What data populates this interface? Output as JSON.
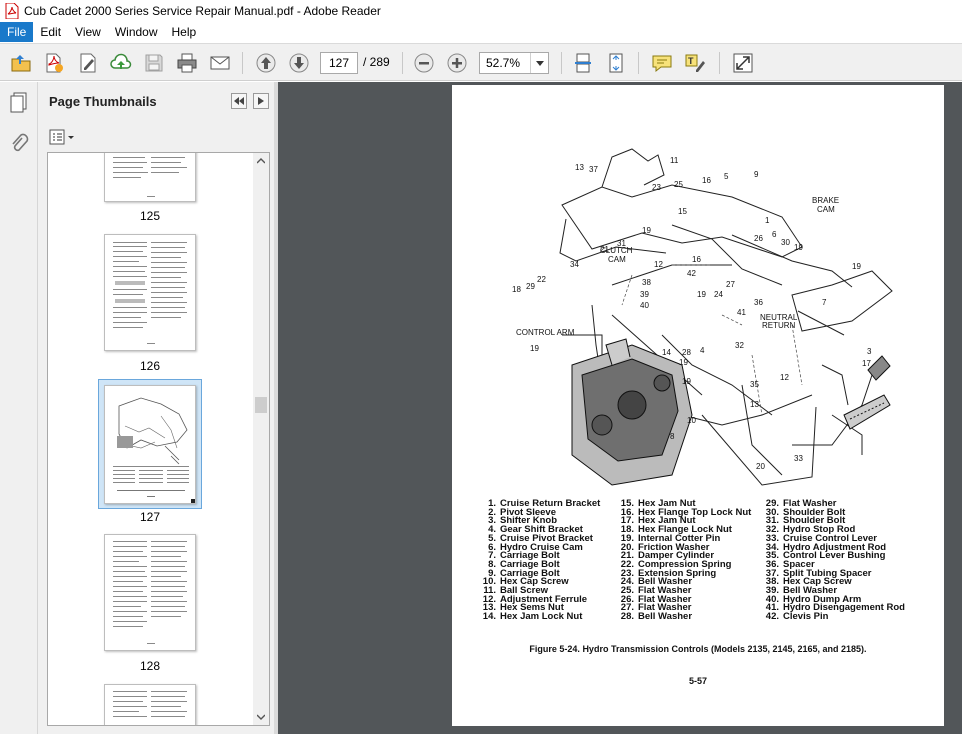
{
  "window": {
    "title": "Cub Cadet 2000 Series Service Repair Manual.pdf - Adobe Reader"
  },
  "menu": {
    "items": [
      "File",
      "Edit",
      "View",
      "Window",
      "Help"
    ]
  },
  "toolbar": {
    "current_page": "127",
    "total_pages": "/ 289",
    "zoom": "52.7%"
  },
  "panel": {
    "title": "Page Thumbnails",
    "thumbnails": [
      {
        "label": "125"
      },
      {
        "label": "126"
      },
      {
        "label": "127"
      },
      {
        "label": "128"
      }
    ]
  },
  "document": {
    "figure": {
      "callouts": [
        "13",
        "37",
        "11",
        "16",
        "5",
        "9",
        "23",
        "25",
        "19",
        "15",
        "1",
        "6",
        "21",
        "31",
        "16",
        "26",
        "30",
        "19",
        "12",
        "42",
        "19",
        "24",
        "27",
        "36",
        "34",
        "38",
        "39",
        "40",
        "22",
        "29",
        "18",
        "41",
        "19",
        "14",
        "28",
        "4",
        "32",
        "12",
        "3",
        "17",
        "35",
        "10",
        "13",
        "8",
        "20",
        "33",
        "7"
      ],
      "labels": {
        "brake_cam": [
          "BRAKE",
          "CAM"
        ],
        "clutch_cam": [
          "CLUTCH",
          "CAM"
        ],
        "neutral_return": [
          "NEUTRAL",
          "RETURN"
        ],
        "control_arm": "CONTROL ARM"
      }
    },
    "legend_col1": [
      {
        "n": "1.",
        "t": "Cruise Return Bracket"
      },
      {
        "n": "2.",
        "t": "Pivot Sleeve"
      },
      {
        "n": "3.",
        "t": "Shifter Knob"
      },
      {
        "n": "4.",
        "t": "Gear Shift Bracket"
      },
      {
        "n": "5.",
        "t": "Cruise Pivot Bracket"
      },
      {
        "n": "6.",
        "t": "Hydro Cruise Cam"
      },
      {
        "n": "7.",
        "t": "Carriage Bolt"
      },
      {
        "n": "8.",
        "t": "Carriage Bolt"
      },
      {
        "n": "9.",
        "t": "Carriage Bolt"
      },
      {
        "n": "10.",
        "t": "Hex Cap Screw"
      },
      {
        "n": "11.",
        "t": "Ball Screw"
      },
      {
        "n": "12.",
        "t": "Adjustment Ferrule"
      },
      {
        "n": "13.",
        "t": "Hex Sems Nut"
      },
      {
        "n": "14.",
        "t": "Hex Jam Lock Nut"
      }
    ],
    "legend_col2": [
      {
        "n": "15.",
        "t": "Hex Jam Nut"
      },
      {
        "n": "16.",
        "t": "Hex Flange Top Lock Nut"
      },
      {
        "n": "17.",
        "t": "Hex Jam Nut"
      },
      {
        "n": "18.",
        "t": "Hex Flange Lock Nut"
      },
      {
        "n": "19.",
        "t": "Internal Cotter Pin"
      },
      {
        "n": "20.",
        "t": "Friction Washer"
      },
      {
        "n": "21.",
        "t": "Damper Cylinder"
      },
      {
        "n": "22.",
        "t": "Compression Spring"
      },
      {
        "n": "23.",
        "t": "Extension Spring"
      },
      {
        "n": "24.",
        "t": "Bell Washer"
      },
      {
        "n": "25.",
        "t": "Flat Washer"
      },
      {
        "n": "26.",
        "t": "Flat Washer"
      },
      {
        "n": "27.",
        "t": "Flat Washer"
      },
      {
        "n": "28.",
        "t": "Bell Washer"
      }
    ],
    "legend_col3": [
      {
        "n": "29.",
        "t": "Flat Washer"
      },
      {
        "n": "30.",
        "t": "Shoulder Bolt"
      },
      {
        "n": "31.",
        "t": "Shoulder Bolt"
      },
      {
        "n": "32.",
        "t": "Hydro Stop Rod"
      },
      {
        "n": "33.",
        "t": "Cruise Control Lever"
      },
      {
        "n": "34.",
        "t": "Hydro Adjustment Rod"
      },
      {
        "n": "35.",
        "t": "Control Lever Bushing"
      },
      {
        "n": "36.",
        "t": "Spacer"
      },
      {
        "n": "37.",
        "t": "Split Tubing Spacer"
      },
      {
        "n": "38.",
        "t": "Hex Cap Screw"
      },
      {
        "n": "39.",
        "t": "Bell Washer"
      },
      {
        "n": "40.",
        "t": "Hydro Dump Arm"
      },
      {
        "n": "41.",
        "t": "Hydro Disengagement Rod"
      },
      {
        "n": "42.",
        "t": "Clevis Pin"
      }
    ],
    "caption": "Figure 5-24. Hydro Transmission Controls (Models 2135, 2145, 2165, and 2185).",
    "page_number": "5-57"
  },
  "icons": [
    "pdf-app-icon",
    "open-icon",
    "create-icon",
    "edit-icon",
    "upload-icon",
    "save-icon",
    "print-icon",
    "email-icon",
    "prev-page-icon",
    "next-page-icon",
    "zoom-out-icon",
    "zoom-in-icon",
    "scroll-mode-icon",
    "fit-page-icon",
    "comment-icon",
    "highlight-icon",
    "fullscreen-icon",
    "pages-icon",
    "attachment-icon",
    "options-icon"
  ],
  "colors": {
    "menu_active": "#1979ca",
    "doc_background": "#525659",
    "panel_background": "#f0f0f0"
  }
}
